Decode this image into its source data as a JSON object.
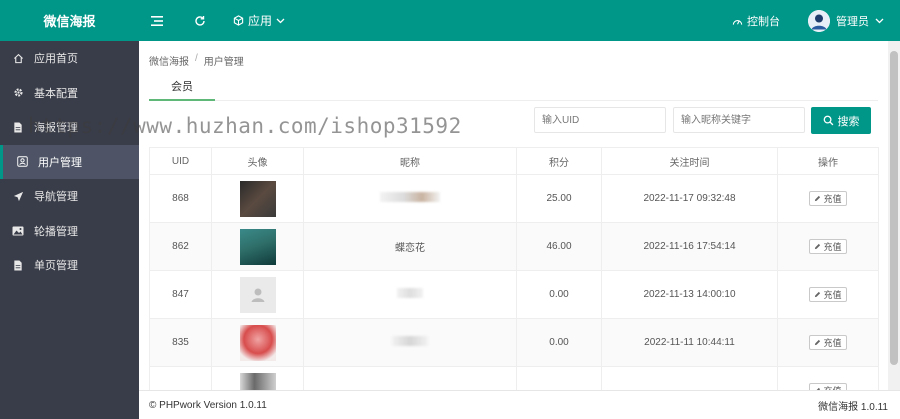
{
  "header": {
    "logo": "微信海报",
    "app_label": "应用",
    "console_label": "控制台",
    "admin_label": "管理员"
  },
  "sidebar": {
    "items": [
      {
        "label": "应用首页",
        "icon": "home-icon"
      },
      {
        "label": "基本配置",
        "icon": "gear-icon"
      },
      {
        "label": "海报管理",
        "icon": "file-icon"
      },
      {
        "label": "用户管理",
        "icon": "user-icon"
      },
      {
        "label": "导航管理",
        "icon": "send-icon"
      },
      {
        "label": "轮播管理",
        "icon": "image-icon"
      },
      {
        "label": "单页管理",
        "icon": "file-icon"
      }
    ],
    "active_index": 3
  },
  "breadcrumb": {
    "root": "微信海报",
    "separator": "/",
    "current": "用户管理"
  },
  "tabs": {
    "member": "会员"
  },
  "search": {
    "uid_placeholder": "输入UID",
    "nickname_placeholder": "输入昵称关键字",
    "button_label": "搜索"
  },
  "table": {
    "headers": [
      "UID",
      "头像",
      "昵称",
      "积分",
      "关注时间",
      "操作"
    ],
    "action_label": "充值",
    "rows": [
      {
        "uid": "868",
        "nickname": "",
        "points": "25.00",
        "time": "2022-11-17 09:32:48"
      },
      {
        "uid": "862",
        "nickname": "蝶恋花",
        "points": "46.00",
        "time": "2022-11-16 17:54:14"
      },
      {
        "uid": "847",
        "nickname": "",
        "points": "0.00",
        "time": "2022-11-13 14:00:10"
      },
      {
        "uid": "835",
        "nickname": "",
        "points": "0.00",
        "time": "2022-11-11 10:44:11"
      }
    ]
  },
  "watermark": "https://www.huzhan.com/ishop31592",
  "footer": {
    "copyright": "© PHPwork Version 1.0.11",
    "app_version": "微信海报 1.0.11"
  },
  "colors": {
    "primary": "#009688",
    "sidebar_bg": "#393d49",
    "active_tab": "#5fb878"
  }
}
